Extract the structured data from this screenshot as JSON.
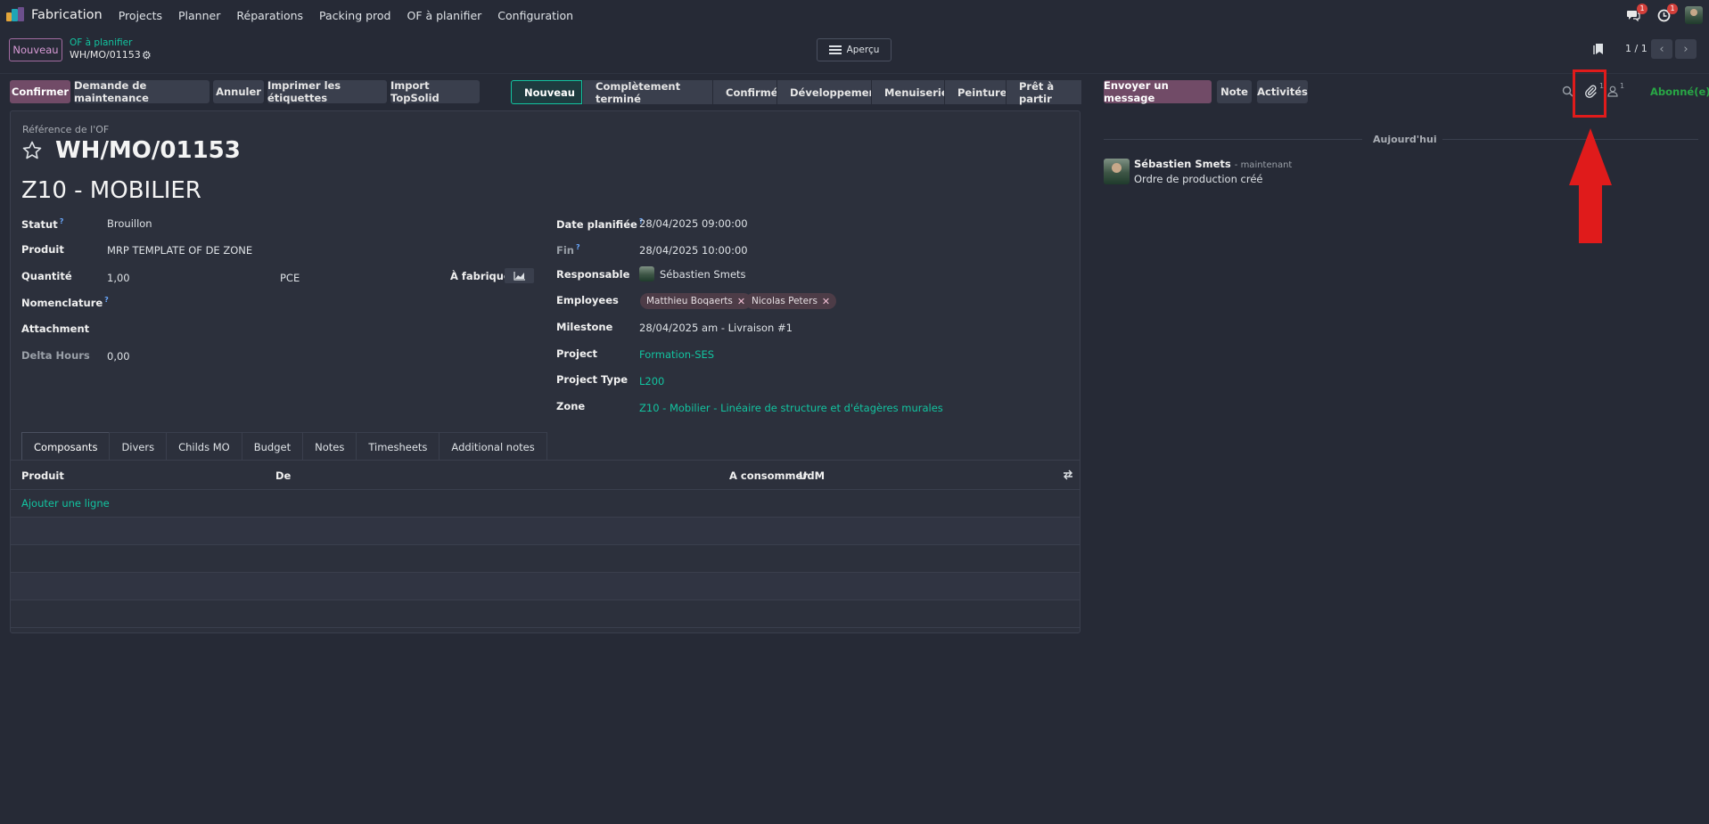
{
  "navbar": {
    "app_name": "Fabrication",
    "menu": [
      "Projects",
      "Planner",
      "Réparations",
      "Packing prod",
      "OF à planifier",
      "Configuration"
    ],
    "messages_badge": "1",
    "activities_badge": "1"
  },
  "control_panel": {
    "new_button": "Nouveau",
    "breadcrumb_parent": "OF à planifier",
    "breadcrumb_current": "WH/MO/01153",
    "view_switch": "Aperçu",
    "pager": "1 / 1"
  },
  "actions": {
    "confirm": "Confirmer",
    "maintenance": "Demande de maintenance",
    "cancel": "Annuler",
    "print_labels": "Imprimer les étiquettes",
    "import": "Import TopSolid"
  },
  "statusbar": [
    "Nouveau",
    "Complètement terminé",
    "Confirmé",
    "Développement",
    "Menuiserie",
    "Peinture",
    "Prêt à partir"
  ],
  "form": {
    "ref_label": "Référence de l'OF",
    "reference": "WH/MO/01153",
    "name": "Z10 - MOBILIER",
    "left": {
      "statut_label": "Statut",
      "statut": "Brouillon",
      "produit_label": "Produit",
      "produit": "MRP TEMPLATE OF DE ZONE",
      "quantite_label": "Quantité",
      "quantite": "1,00",
      "uom": "PCE",
      "a_fabriquer": "À fabriquer",
      "nomenclature_label": "Nomenclature",
      "attachment_label": "Attachment",
      "delta_label": "Delta Hours",
      "delta": "0,00"
    },
    "right": {
      "date_label": "Date planifiée",
      "date": "28/04/2025 09:00:00",
      "fin_label": "Fin",
      "fin": "28/04/2025 10:00:00",
      "resp_label": "Responsable",
      "resp": "Sébastien Smets",
      "employees_label": "Employees",
      "employees": [
        "Matthieu Boqaerts",
        "Nicolas Peters"
      ],
      "milestone_label": "Milestone",
      "milestone": "28/04/2025 am - Livraison #1",
      "project_label": "Project",
      "project": "Formation-SES",
      "ptype_label": "Project Type",
      "ptype": "L200",
      "zone_label": "Zone",
      "zone": "Z10 - Mobilier - Linéaire de structure et d'étagères murales"
    },
    "tabs": [
      "Composants",
      "Divers",
      "Childs MO",
      "Budget",
      "Notes",
      "Timesheets",
      "Additional notes"
    ],
    "table": {
      "headers": [
        "Produit",
        "De",
        "A consommer",
        "UdM"
      ],
      "add_line": "Ajouter une ligne"
    }
  },
  "chatter": {
    "send_message": "Envoyer un message",
    "note": "Note",
    "activities": "Activités",
    "attachments_count": "1",
    "followers_count": "1",
    "follow_status": "Abonné(e)",
    "date_separator": "Aujourd'hui",
    "message": {
      "author": "Sébastien Smets",
      "time": "- maintenant",
      "body": "Ordre de production créé"
    }
  },
  "colors": {
    "primary": "#714b67",
    "accent": "#12c4a0",
    "annotation": "#e01b1b",
    "background": "#262a36"
  }
}
